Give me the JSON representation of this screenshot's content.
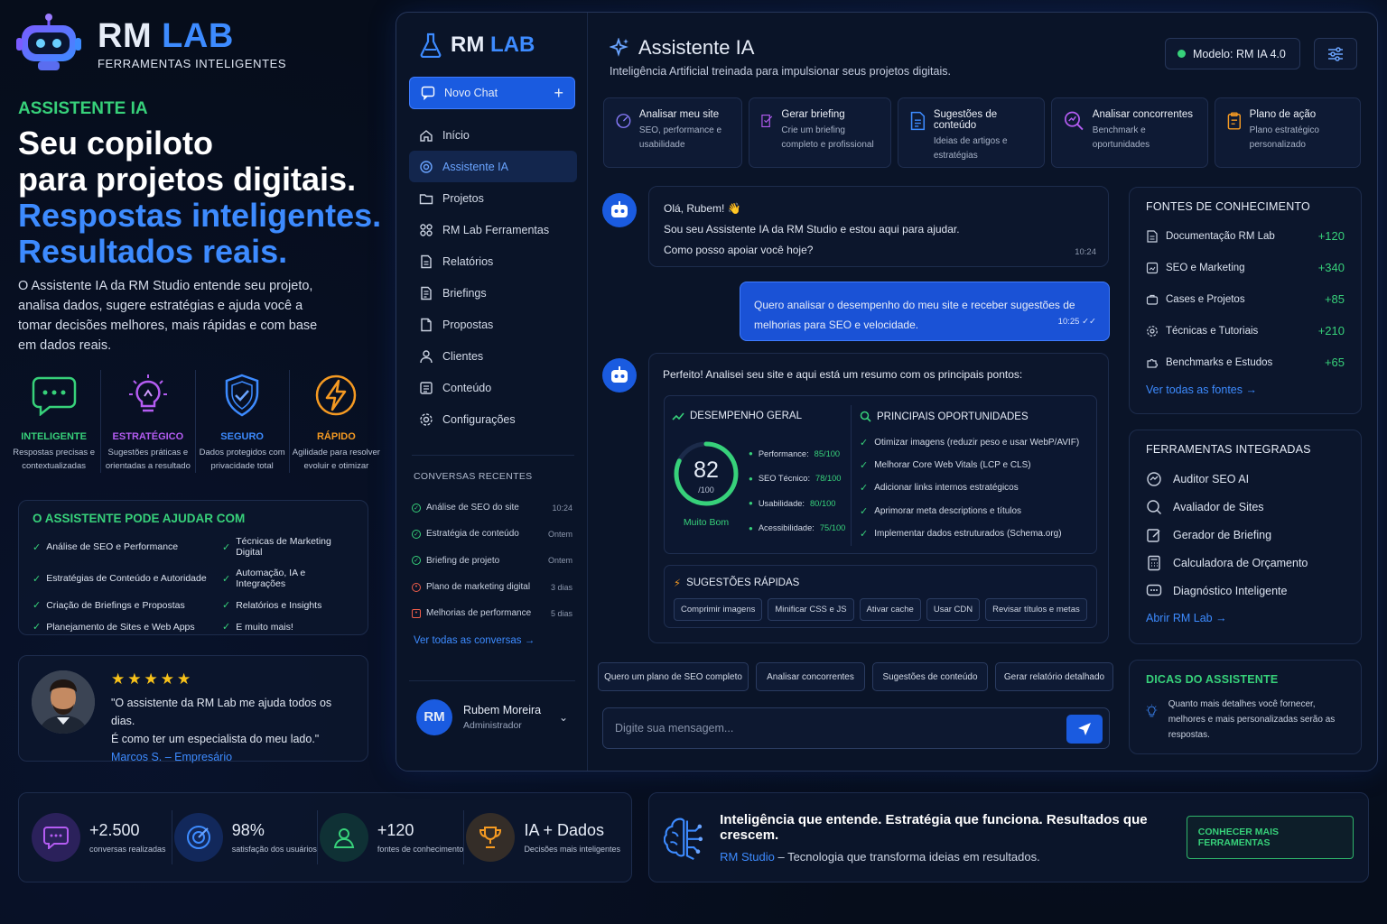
{
  "brand": {
    "rm": "RM",
    "lab": "LAB",
    "subtitle": "FERRAMENTAS INTELIGENTES"
  },
  "hero": {
    "tag": "ASSISTENTE IA",
    "line1": "Seu copiloto",
    "line2": "para projetos digitais.",
    "line3": "Respostas inteligentes.",
    "line4": "Resultados reais.",
    "desc": "O Assistente IA da RM Studio entende seu projeto, analisa dados, sugere estratégias e ajuda você a tomar decisões melhores, mais rápidas e com base em dados reais."
  },
  "features": [
    {
      "title": "INTELIGENTE",
      "desc": "Respostas precisas e contextualizadas",
      "color": "#37d17a"
    },
    {
      "title": "ESTRATÉGICO",
      "desc": "Sugestões práticas e orientadas a resultado",
      "color": "#b45cf2"
    },
    {
      "title": "SEGURO",
      "desc": "Dados protegidos com privacidade total",
      "color": "#3d8bff"
    },
    {
      "title": "RÁPIDO",
      "desc": "Agilidade para resolver evoluir e otimizar",
      "color": "#f59a22"
    }
  ],
  "help": {
    "title": "O ASSISTENTE PODE AJUDAR COM",
    "items": [
      "Análise de SEO e Performance",
      "Técnicas de Marketing Digital",
      "Estratégias de Conteúdo e Autoridade",
      "Automação, IA e Integrações",
      "Criação de Briefings e Propostas",
      "Relatórios e Insights",
      "Planejamento de Sites e Web Apps",
      "E muito mais!"
    ]
  },
  "testimonial": {
    "stars": "★★★★★",
    "quote1": "\"O assistente da RM Lab me ajuda todos os dias.",
    "quote2": "É como ter um especialista do meu lado.\"",
    "author": "Marcos S. – Empresário"
  },
  "stats": [
    {
      "value": "+2.500",
      "label": "conversas realizadas"
    },
    {
      "value": "98%",
      "label": "satisfação dos usuários"
    },
    {
      "value": "+120",
      "label": "fontes de conhecimento"
    },
    {
      "value": "IA + Dados",
      "label": "Decisões mais inteligentes"
    }
  ],
  "banner": {
    "headline": "Inteligência que entende. Estratégia que funciona. Resultados que crescem.",
    "brand": "RM Studio",
    "tagline": " – Tecnologia que transforma ideias em resultados.",
    "button": "CONHECER MAIS FERRAMENTAS"
  },
  "sidebar": {
    "new_chat": "Novo Chat",
    "nav": [
      "Início",
      "Assistente IA",
      "Projetos",
      "RM Lab Ferramentas",
      "Relatórios",
      "Briefings",
      "Propostas",
      "Clientes",
      "Conteúdo",
      "Configurações"
    ],
    "recent_title": "CONVERSAS RECENTES",
    "recent": [
      {
        "title": "Análise de SEO do site",
        "time": "10:24"
      },
      {
        "title": "Estratégia de conteúdo",
        "time": "Ontem"
      },
      {
        "title": "Briefing de projeto",
        "time": "Ontem"
      },
      {
        "title": "Plano de marketing digital",
        "time": "3 dias"
      },
      {
        "title": "Melhorias de performance",
        "time": "5 dias"
      }
    ],
    "all_conversations": "Ver todas as conversas",
    "user": {
      "initials": "RM",
      "name": "Rubem Moreira",
      "role": "Administrador"
    }
  },
  "header": {
    "title": "Assistente IA",
    "subtitle": "Inteligência Artificial treinada para impulsionar seus projetos digitais.",
    "model": "Modelo: RM IA 4.0"
  },
  "quick_actions": [
    {
      "title": "Analisar meu site",
      "desc": "SEO, performance e usabilidade"
    },
    {
      "title": "Gerar briefing",
      "desc": "Crie um briefing completo e profissional"
    },
    {
      "title": "Sugestões de conteúdo",
      "desc": "Ideias de artigos e estratégias"
    },
    {
      "title": "Analisar concorrentes",
      "desc": "Benchmark e oportunidades"
    },
    {
      "title": "Plano de ação",
      "desc": "Plano estratégico personalizado"
    }
  ],
  "chat": {
    "bot1": {
      "line1": "Olá, Rubem! 👋",
      "line2": "Sou seu Assistente IA da RM Studio e estou aqui para ajudar.",
      "line3": "Como posso apoiar você hoje?",
      "time": "10:24"
    },
    "user": {
      "text": "Quero analisar o desempenho do meu site e receber sugestões de melhorias para SEO e velocidade.",
      "time": "10:25"
    },
    "bot2": {
      "intro": "Perfeito! Analisei seu site e aqui está um resumo com os principais pontos:",
      "perf_title": "DESEMPENHO GERAL",
      "score": "82",
      "score_max": "/100",
      "score_fraction": 0.82,
      "score_label": "Muito Bom",
      "metrics": [
        {
          "label": "Performance:",
          "value": "85/100"
        },
        {
          "label": "SEO Técnico:",
          "value": "78/100"
        },
        {
          "label": "Usabilidade:",
          "value": "80/100"
        },
        {
          "label": "Acessibilidade:",
          "value": "75/100"
        }
      ],
      "opp_title": "PRINCIPAIS OPORTUNIDADES",
      "opps": [
        "Otimizar imagens (reduzir peso e usar WebP/AVIF)",
        "Melhorar Core Web Vitals (LCP e CLS)",
        "Adicionar links internos estratégicos",
        "Aprimorar meta descriptions e títulos",
        "Implementar dados estruturados (Schema.org)"
      ],
      "sug_title": "SUGESTÕES RÁPIDAS",
      "chips": [
        "Comprimir imagens",
        "Minificar CSS e JS",
        "Ativar cache",
        "Usar CDN",
        "Revisar títulos e metas"
      ]
    },
    "bottom_chips": [
      "Quero um plano de SEO completo",
      "Analisar concorrentes",
      "Sugestões de conteúdo",
      "Gerar relatório detalhado"
    ],
    "input_placeholder": "Digite sua mensagem..."
  },
  "knowledge": {
    "title": "FONTES DE CONHECIMENTO",
    "items": [
      {
        "label": "Documentação RM Lab",
        "count": "+120"
      },
      {
        "label": "SEO e Marketing",
        "count": "+340"
      },
      {
        "label": "Cases e Projetos",
        "count": "+85"
      },
      {
        "label": "Técnicas e Tutoriais",
        "count": "+210"
      },
      {
        "label": "Benchmarks e Estudos",
        "count": "+65"
      }
    ],
    "link": "Ver todas as fontes"
  },
  "tools": {
    "title": "FERRAMENTAS INTEGRADAS",
    "items": [
      "Auditor SEO AI",
      "Avaliador de Sites",
      "Gerador de Briefing",
      "Calculadora de Orçamento",
      "Diagnóstico Inteligente"
    ],
    "link": "Abrir RM Lab"
  },
  "tips": {
    "title": "DICAS DO ASSISTENTE",
    "text": "Quanto mais detalhes você fornecer, melhores e mais personalizadas serão as respostas."
  }
}
